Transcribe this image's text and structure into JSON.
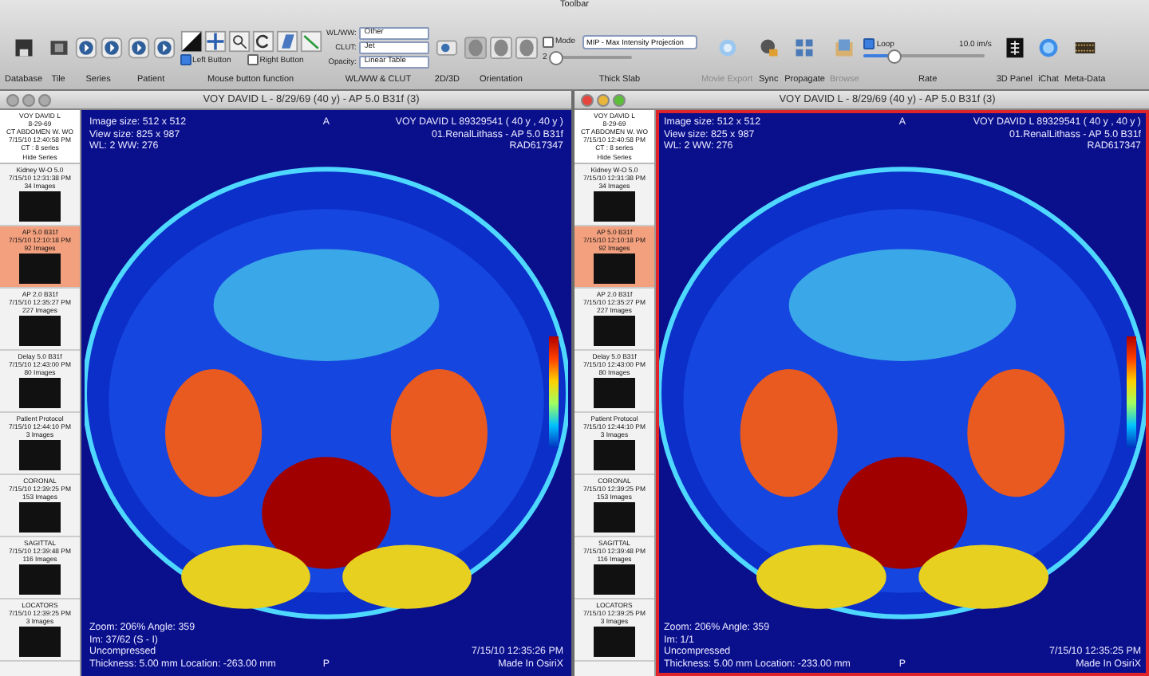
{
  "toolbar": {
    "title": "Toolbar",
    "groups": [
      {
        "kind": "disk",
        "label": "Database"
      },
      {
        "kind": "film",
        "label": "Tile"
      },
      {
        "kind": "arrows",
        "label": "Series"
      },
      {
        "kind": "arrows",
        "label": "Patient"
      },
      {
        "kind": "mouse",
        "label": "Mouse button function",
        "options": [
          {
            "label": "Left Button",
            "checked": true
          },
          {
            "label": "Right Button",
            "checked": false
          }
        ]
      },
      {
        "kind": "selects",
        "label": "WL/WW & CLUT",
        "fields": [
          {
            "label": "WL/WW:",
            "value": "Other"
          },
          {
            "label": "CLUT:",
            "value": "Jet"
          },
          {
            "label": "Opacity:",
            "value": "Linear Table"
          }
        ]
      },
      {
        "kind": "popup",
        "label": "2D/3D"
      },
      {
        "kind": "heads",
        "label": "Orientation"
      },
      {
        "kind": "slab",
        "label": "Thick Slab",
        "mode": {
          "label": "Mode",
          "checked": false
        },
        "value": "2",
        "level": 0.05,
        "menu": "MIP - Max Intensity Projection"
      },
      {
        "kind": "movie",
        "label": "Movie Export",
        "disabled": true
      },
      {
        "kind": "sync",
        "label": "Sync",
        "disabled": false
      },
      {
        "kind": "grid",
        "label": "Propagate",
        "disabled": false
      },
      {
        "kind": "browse",
        "label": "Browse",
        "disabled": true
      },
      {
        "kind": "rate",
        "label": "Rate",
        "loop": {
          "label": "Loop",
          "checked": true
        },
        "speed": "10.0 im/s",
        "level": 0.25
      },
      {
        "kind": "panel",
        "label": "3D Panel"
      },
      {
        "kind": "chat",
        "label": "iChat"
      },
      {
        "kind": "meta",
        "label": "Meta-Data"
      }
    ]
  },
  "viewers": [
    {
      "title": "VOY DAVID L - 8/29/69 (40 y) - AP  5.0  B31f (3)",
      "selected": false,
      "series_list": {
        "header": [
          "VOY DAVID L",
          "8-29-69",
          "CT ABDOMEN W. WO",
          "7/15/10 12:40:58 PM",
          "CT : 8 series"
        ],
        "hide": "Hide Series",
        "items": [
          {
            "name": "Kidney W-O  5.0",
            "date": "7/15/10 12:31:38 PM",
            "count": "34 Images",
            "selected": false
          },
          {
            "name": "AP  5.0  B31f",
            "date": "7/15/10 12:10:18 PM",
            "count": "92 Images",
            "selected": true
          },
          {
            "name": "AP  2.0  B31f",
            "date": "7/15/10 12:35:27 PM",
            "count": "227 Images",
            "selected": false
          },
          {
            "name": "Delay  5.0  B31f",
            "date": "7/15/10 12:43:00 PM",
            "count": "80 Images",
            "selected": false
          },
          {
            "name": "Patient Protocol",
            "date": "7/15/10 12:44:10 PM",
            "count": "3 Images",
            "selected": false
          },
          {
            "name": "CORONAL",
            "date": "7/15/10 12:39:25 PM",
            "count": "153 Images",
            "selected": false
          },
          {
            "name": "SAGITTAL",
            "date": "7/15/10 12:39:48 PM",
            "count": "116 Images",
            "selected": false
          },
          {
            "name": "LOCATORS",
            "date": "7/15/10 12:39:25 PM",
            "count": "3 Images",
            "selected": false
          }
        ]
      },
      "image": {
        "top_left": [
          "Image size: 512 x 512",
          "View size: 825 x 987",
          "WL: 2 WW: 276"
        ],
        "top_center": "A",
        "top_right": [
          "VOY DAVID L 89329541 ( 40 y , 40 y )",
          "01.RenalLithass - AP  5.0  B31f",
          "RAD617347"
        ],
        "bottom_left": [
          "Zoom: 206% Angle: 359",
          "Im: 37/62 (S - I)",
          "Uncompressed",
          "Thickness: 5.00 mm Location: -263.00 mm"
        ],
        "bottom_center": "P",
        "bottom_right": [
          "7/15/10 12:35:26 PM",
          "Made In OsiriX"
        ]
      }
    },
    {
      "title": "VOY DAVID L - 8/29/69 (40 y) - AP  5.0  B31f (3)",
      "selected": true,
      "series_list": {
        "header": [
          "VOY DAVID L",
          "8-29-69",
          "CT ABDOMEN W. WO",
          "7/15/10 12:40:58 PM",
          "CT : 8 series"
        ],
        "hide": "Hide Series",
        "items": [
          {
            "name": "Kidney W-O  5.0",
            "date": "7/15/10 12:31:38 PM",
            "count": "34 Images",
            "selected": false
          },
          {
            "name": "AP  5.0  B31f",
            "date": "7/15/10 12:10:18 PM",
            "count": "92 Images",
            "selected": true
          },
          {
            "name": "AP  2.0  B31f",
            "date": "7/15/10 12:35:27 PM",
            "count": "227 Images",
            "selected": false
          },
          {
            "name": "Delay  5.0  B31f",
            "date": "7/15/10 12:43:00 PM",
            "count": "80 Images",
            "selected": false
          },
          {
            "name": "Patient Protocol",
            "date": "7/15/10 12:44:10 PM",
            "count": "3 Images",
            "selected": false
          },
          {
            "name": "CORONAL",
            "date": "7/15/10 12:39:25 PM",
            "count": "153 Images",
            "selected": false
          },
          {
            "name": "SAGITTAL",
            "date": "7/15/10 12:39:48 PM",
            "count": "116 Images",
            "selected": false
          },
          {
            "name": "LOCATORS",
            "date": "7/15/10 12:39:25 PM",
            "count": "3 Images",
            "selected": false
          }
        ]
      },
      "image": {
        "top_left": [
          "Image size: 512 x 512",
          "View size: 825 x 987",
          "WL: 2 WW: 276"
        ],
        "top_center": "A",
        "top_right": [
          "VOY DAVID L 89329541 ( 40 y , 40 y )",
          "01.RenalLithass - AP  5.0  B31f",
          "RAD617347"
        ],
        "bottom_left": [
          "Zoom: 206% Angle: 359",
          "Im: 1/1",
          "Uncompressed",
          "Thickness: 5.00 mm Location: -233.00 mm"
        ],
        "bottom_center": "P",
        "bottom_right": [
          "7/15/10 12:35:25 PM",
          "Made In OsiriX"
        ]
      }
    }
  ]
}
